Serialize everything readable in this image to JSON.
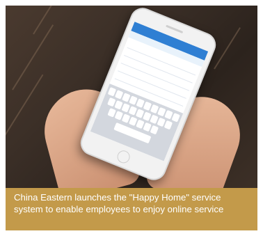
{
  "caption": {
    "text": "China Eastern launches the \"Happy Home\" service system to enable employees to enjoy online service"
  },
  "colors": {
    "caption_bg": "#c39a4a",
    "caption_text": "#ffffff",
    "photo_bg": "#3b2f27"
  },
  "photo": {
    "subject": "hands-holding-phone"
  }
}
